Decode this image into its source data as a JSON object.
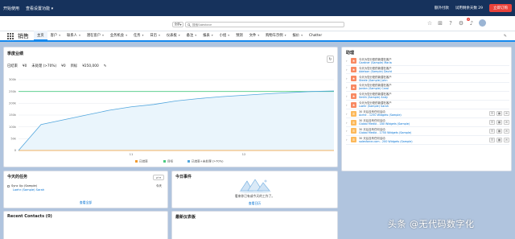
{
  "topbar": {
    "left_items": [
      "开始使用",
      "查看设置功能"
    ],
    "right_items": [
      "额外付款",
      "试用剩余天数",
      "29"
    ],
    "buy_label": "立即订购"
  },
  "search": {
    "scope": "全部",
    "placeholder": "搜索Salesforce"
  },
  "notif_count": "2",
  "nav": {
    "app_name": "销售",
    "tabs": [
      {
        "label": "主页",
        "chev": false,
        "active": true
      },
      {
        "label": "客户",
        "chev": true
      },
      {
        "label": "联系人",
        "chev": true
      },
      {
        "label": "潜在客户",
        "chev": true
      },
      {
        "label": "业务机会",
        "chev": true
      },
      {
        "label": "任务",
        "chev": true
      },
      {
        "label": "日历",
        "chev": true
      },
      {
        "label": "仪表板",
        "chev": true
      },
      {
        "label": "备注",
        "chev": true
      },
      {
        "label": "报表",
        "chev": true
      },
      {
        "label": "小组",
        "chev": true
      },
      {
        "label": "预测",
        "chev": false
      },
      {
        "label": "文件",
        "chev": true
      },
      {
        "label": "购物车示例",
        "chev": true
      },
      {
        "label": "报价",
        "chev": true
      },
      {
        "label": "Chatter",
        "chev": false
      }
    ]
  },
  "performance": {
    "title": "季度业绩",
    "closed_label": "已结束",
    "closed_value": "¥0",
    "open_label": "未处理 (>70%)",
    "open_value": "¥0",
    "goal_label": "目标",
    "goal_value": "¥250,000"
  },
  "chart_data": {
    "type": "line",
    "x_tick_labels": [
      "11",
      "12"
    ],
    "y_tick_labels": [
      "0",
      "50k",
      "100k",
      "150k",
      "200k",
      "250k",
      "300k"
    ],
    "ylim": [
      0,
      300000
    ],
    "series": [
      {
        "name": "已结束",
        "color": "#f29a2e",
        "values": [
          0,
          0,
          0,
          0,
          0,
          0,
          0,
          0,
          0,
          0,
          0,
          0,
          0,
          0,
          0
        ]
      },
      {
        "name": "目标",
        "color": "#4bca81",
        "values": [
          250000,
          250000,
          250000,
          250000,
          250000,
          250000,
          250000,
          250000,
          250000,
          250000,
          250000,
          250000,
          250000,
          250000,
          250000
        ]
      },
      {
        "name": "已结束+未处理 (>70%)",
        "color": "#52a6dd",
        "values": [
          0,
          110000,
          130000,
          150000,
          170000,
          185000,
          195000,
          210000,
          220000,
          228000,
          234000,
          240000,
          245000,
          250000,
          252000
        ]
      }
    ],
    "legend_position": "bottom"
  },
  "assistant": {
    "title": "助理",
    "items": [
      {
        "line1": "今天为您分配的新潜在客户",
        "line2": "Gardner (Sample) Maria",
        "type": "lead",
        "actions": false
      },
      {
        "line1": "今天为您分配的新潜在客户",
        "line2": "Adelson (Sample) David",
        "type": "lead",
        "actions": false
      },
      {
        "line1": "今天为您分配的新潜在客户",
        "line2": "Steele (Sample) John",
        "type": "lead",
        "actions": false
      },
      {
        "line1": "今天为您分配的新潜在客户",
        "line2": "Jordan (Sample) Carol",
        "type": "lead",
        "actions": false
      },
      {
        "line1": "今天为您分配的新潜在客户",
        "line2": "Smith (Sample) Andy",
        "type": "lead",
        "actions": false
      },
      {
        "line1": "今天为您分配的新潜在客户",
        "line2": "Loehr (Sample) Sarah",
        "type": "lead",
        "actions": false
      },
      {
        "line1": "30 天后没有任何活动",
        "line2": "Acme - 1250 Widgets (Sample)",
        "type": "opp",
        "actions": true
      },
      {
        "line1": "30 天后没有任何活动",
        "line2": "Global Media - 180 Widgets (Sample)",
        "type": "opp",
        "actions": true
      },
      {
        "line1": "30 天后没有任何活动",
        "line2": "Global Media - 1750 Widgets (Sample)",
        "type": "opp",
        "actions": true
      },
      {
        "line1": "30 天后没有任何活动",
        "line2": "salesforce.com - 200 Widgets (Sample)",
        "type": "opp",
        "actions": true
      }
    ]
  },
  "tasks": {
    "title": "今天的任务",
    "dropdown": "⇄ ▾",
    "task_title": "Sync Up (Sample)",
    "task_who": "Loehr (Sample) Sarah",
    "task_due": "今天",
    "view_all": "查看全部"
  },
  "events": {
    "title": "今日事件",
    "empty_msg": "看来你已有或今天的工作了。",
    "view_calendar": "查看日历"
  },
  "recent": {
    "title": "Recent Contacts (0)"
  },
  "dashboard": {
    "title": "最新仪表板"
  },
  "watermark": "头条 @无代码数字化"
}
